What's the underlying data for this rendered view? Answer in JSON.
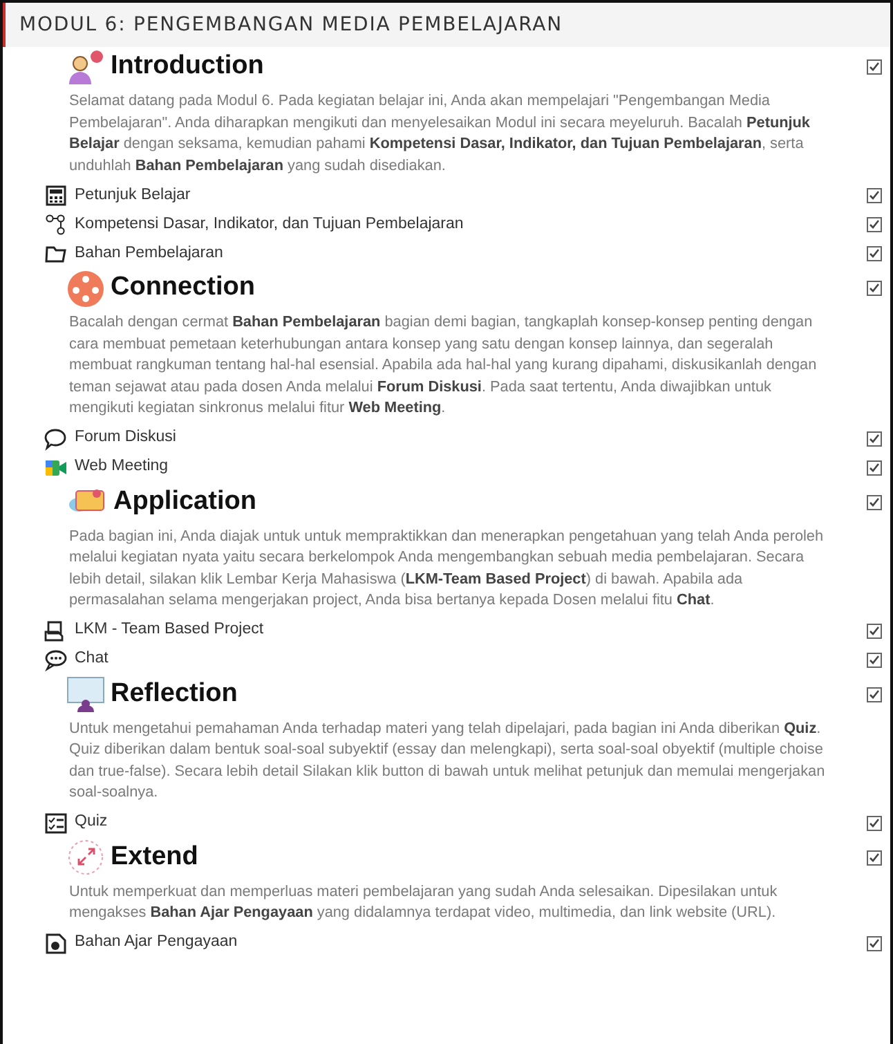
{
  "module_title": "MODUL 6: PENGEMBANGAN MEDIA PEMBELAJARAN",
  "sections": [
    {
      "title": "Introduction",
      "checked": true,
      "description": "Selamat datang pada Modul 6. Pada kegiatan belajar ini, Anda akan mempelajari \"Pengembangan Media Pembelajaran\". Anda diharapkan mengikuti dan menyelesaikan Modul ini secara meyeluruh. Bacalah **Petunjuk Belajar** dengan seksama, kemudian pahami **Kompetensi Dasar, Indikator, dan Tujuan Pembelajaran**, serta unduhlah **Bahan Pembelajaran** yang sudah disediakan.",
      "activities": [
        {
          "kind": "page",
          "label": "Petunjuk Belajar",
          "checked": true
        },
        {
          "kind": "outline",
          "label": "Kompetensi Dasar, Indikator, dan Tujuan Pembelajaran",
          "checked": true
        },
        {
          "kind": "folder",
          "label": "Bahan Pembelajaran",
          "checked": true
        }
      ]
    },
    {
      "title": "Connection",
      "checked": true,
      "description": "Bacalah dengan cermat **Bahan Pembelajaran** bagian demi bagian, tangkaplah konsep-konsep penting dengan cara membuat pemetaan keterhubungan antara konsep yang satu dengan konsep lainnya, dan segeralah membuat rangkuman tentang hal-hal esensial. Apabila ada hal-hal yang kurang dipahami, diskusikanlah dengan teman sejawat atau pada dosen Anda melalui **Forum Diskusi**. Pada saat tertentu, Anda diwajibkan untuk mengikuti kegiatan sinkronus melalui fitur **Web Meeting**.",
      "activities": [
        {
          "kind": "forum",
          "label": "Forum Diskusi",
          "checked": true
        },
        {
          "kind": "meeting",
          "label": "Web Meeting",
          "checked": true
        }
      ]
    },
    {
      "title": "Application",
      "checked": true,
      "description": "Pada bagian ini, Anda diajak untuk untuk mempraktikkan dan menerapkan pengetahuan yang telah Anda peroleh melalui kegiatan nyata yaitu secara berkelompok Anda mengembangkan sebuah media pembelajaran. Secara lebih detail, silakan klik Lembar Kerja Mahasiswa (**LKM-Team Based Project**) di bawah. Apabila ada permasalahan selama mengerjakan project, Anda bisa bertanya kepada Dosen melalui fitu **Chat**.",
      "activities": [
        {
          "kind": "assignment",
          "label": "LKM - Team Based Project",
          "checked": true
        },
        {
          "kind": "chat",
          "label": "Chat",
          "checked": true
        }
      ]
    },
    {
      "title": "Reflection",
      "checked": true,
      "description": "Untuk mengetahui pemahaman Anda terhadap materi yang telah dipelajari, pada bagian ini Anda diberikan **Quiz**. Quiz diberikan dalam bentuk soal-soal subyektif (essay dan melengkapi), serta soal-soal obyektif (multiple choise dan true-false). Secara lebih detail Silakan klik button di bawah untuk melihat petunjuk dan memulai mengerjakan soal-soalnya.",
      "activities": [
        {
          "kind": "quiz",
          "label": "Quiz",
          "checked": true
        }
      ]
    },
    {
      "title": "Extend",
      "checked": true,
      "description": "Untuk memperkuat dan memperluas materi pembelajaran yang sudah Anda selesaikan. Dipesilakan untuk mengakses **Bahan Ajar Pengayaan** yang didalamnya terdapat video, multimedia, dan link website (URL).",
      "activities": [
        {
          "kind": "resource",
          "label": "Bahan Ajar Pengayaan",
          "checked": true
        }
      ]
    }
  ]
}
